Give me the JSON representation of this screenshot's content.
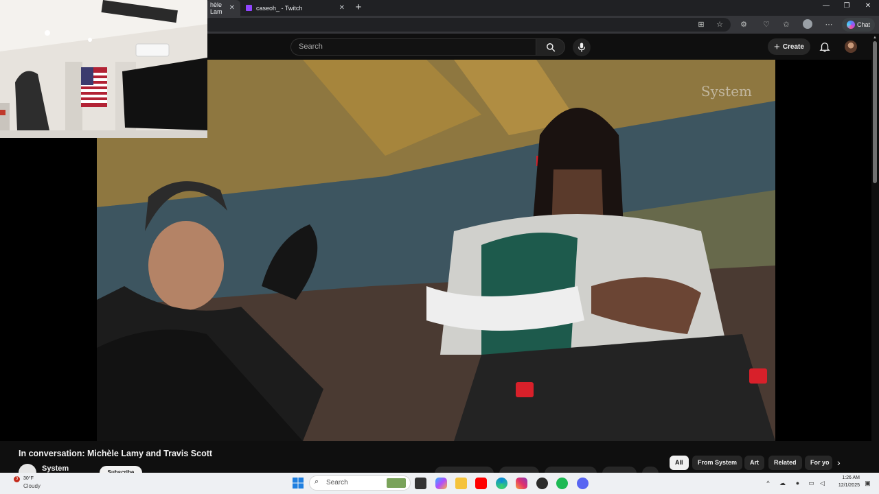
{
  "browser": {
    "tabs": [
      {
        "label": "hèle Lam"
      },
      {
        "label": "caseoh_ - Twitch"
      }
    ]
  },
  "masthead": {
    "search_placeholder": "Search",
    "create_label": "Create"
  },
  "browser_toolbar": {
    "chat_label": "Chat"
  },
  "video": {
    "watermark": "System",
    "title": "In conversation: Michèle Lamy and Travis Scott",
    "channel": "System",
    "subscribe_label": "Subscribe"
  },
  "chips": [
    "All",
    "From System",
    "Art",
    "Related",
    "For yo"
  ],
  "taskbar": {
    "weather_temp": "30°F",
    "weather_desc": "Cloudy",
    "weather_badge": "3",
    "search_label": "Search",
    "time": "1:26 AM",
    "date": "12/1/2025"
  },
  "colors": {
    "yt_bg": "#0f0f0f",
    "chip_selected": "#f1f1f1",
    "twitch_purple": "#9146ff",
    "youtube_red": "#ff0000"
  }
}
